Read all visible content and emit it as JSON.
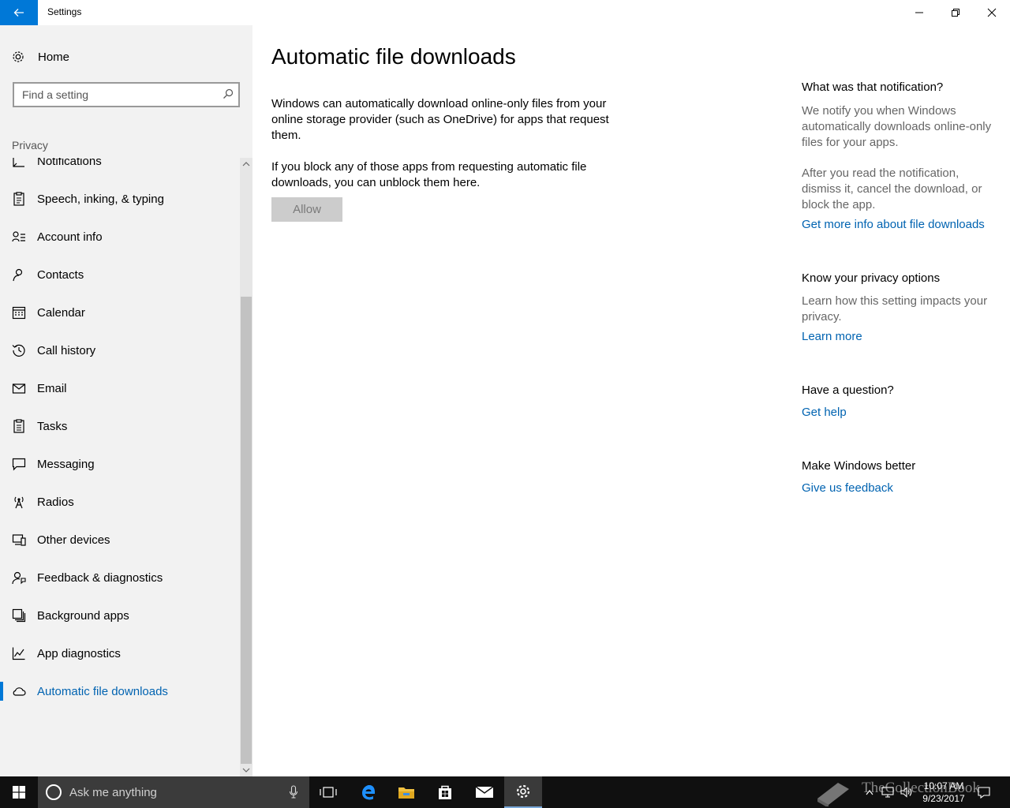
{
  "window": {
    "title": "Settings"
  },
  "sidebar": {
    "home_label": "Home",
    "search_placeholder": "Find a setting",
    "section_label": "Privacy",
    "items": [
      {
        "label": "Notifications",
        "icon": "notifications-icon"
      },
      {
        "label": "Speech, inking, & typing",
        "icon": "speech-icon"
      },
      {
        "label": "Account info",
        "icon": "account-info-icon"
      },
      {
        "label": "Contacts",
        "icon": "contacts-icon"
      },
      {
        "label": "Calendar",
        "icon": "calendar-icon"
      },
      {
        "label": "Call history",
        "icon": "call-history-icon"
      },
      {
        "label": "Email",
        "icon": "email-icon"
      },
      {
        "label": "Tasks",
        "icon": "tasks-icon"
      },
      {
        "label": "Messaging",
        "icon": "messaging-icon"
      },
      {
        "label": "Radios",
        "icon": "radios-icon"
      },
      {
        "label": "Other devices",
        "icon": "other-devices-icon"
      },
      {
        "label": "Feedback & diagnostics",
        "icon": "feedback-icon"
      },
      {
        "label": "Background apps",
        "icon": "background-apps-icon"
      },
      {
        "label": "App diagnostics",
        "icon": "app-diagnostics-icon"
      },
      {
        "label": "Automatic file downloads",
        "icon": "cloud-icon",
        "selected": true
      }
    ]
  },
  "main": {
    "title": "Automatic file downloads",
    "paragraph1": "Windows can automatically download online-only files from your online storage provider (such as OneDrive) for apps that request them.",
    "paragraph2": "If you block any of those apps from requesting automatic file downloads, you can unblock them here.",
    "allow_button": "Allow"
  },
  "right_panel": {
    "notification_heading": "What was that notification?",
    "notification_text1": "We notify you when Windows automatically downloads online-only files for your apps.",
    "notification_text2": "After you read the notification, dismiss it, cancel the download, or block the app.",
    "notification_link": "Get more info about file downloads",
    "privacy_heading": "Know your privacy options",
    "privacy_text": "Learn how this setting impacts your privacy.",
    "privacy_link": "Learn more",
    "question_heading": "Have a question?",
    "question_link": "Get help",
    "better_heading": "Make Windows better",
    "better_link": "Give us feedback"
  },
  "taskbar": {
    "search_placeholder": "Ask me anything",
    "time": "10:07 AM",
    "date": "9/23/2017"
  },
  "watermark": {
    "text": "TheCollectionBook"
  },
  "colors": {
    "accent": "#0078d7",
    "link": "#0063b1",
    "taskbar": "#101010",
    "sidebar": "#f2f2f2"
  }
}
